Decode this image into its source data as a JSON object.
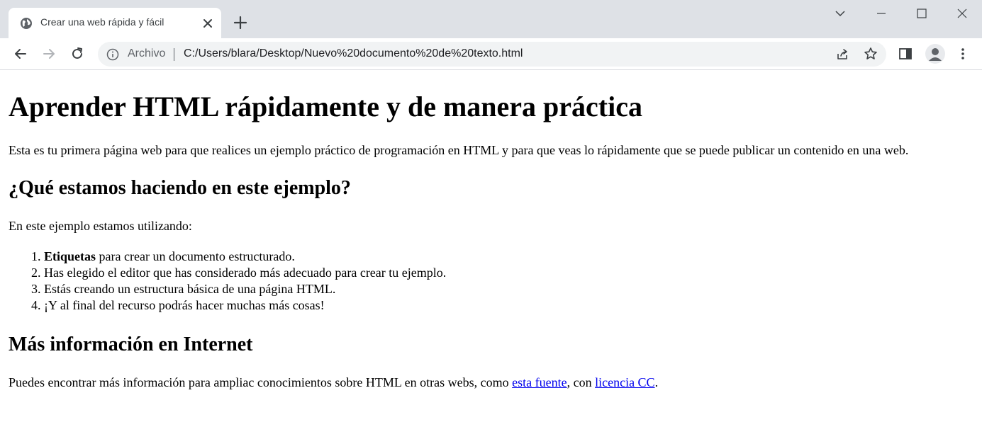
{
  "browser": {
    "tab": {
      "title": "Crear una web rápida y fácil"
    },
    "omnibox": {
      "chip": "Archivo",
      "url": "C:/Users/blara/Desktop/Nuevo%20documento%20de%20texto.html"
    },
    "icons": [
      "globe-icon",
      "close-icon",
      "plus-icon",
      "chevron-down-icon",
      "minimize-icon",
      "maximize-icon",
      "close-window-icon",
      "back-icon",
      "forward-icon",
      "reload-icon",
      "info-icon",
      "share-icon",
      "star-icon",
      "side-panel-icon",
      "avatar",
      "kebab-menu-icon"
    ]
  },
  "page": {
    "h1": "Aprender HTML rápidamente y de manera práctica",
    "intro": "Esta es tu primera página web para que realices un ejemplo práctico de programación en HTML y para que veas lo rápidamente que se puede publicar un contenido en una web.",
    "h2_what": "¿Qué estamos haciendo en este ejemplo?",
    "uses": "En este ejemplo estamos utilizando:",
    "list": [
      {
        "bold": "Etiquetas",
        "text": " para crear un documento estructurado."
      },
      {
        "text": "Has elegido el editor que has considerado más adecuado para crear tu ejemplo."
      },
      {
        "text": "Estás creando un estructura básica de una página HTML."
      },
      {
        "text": "¡Y al final del recurso podrás hacer muchas más cosas!"
      }
    ],
    "h2_more": "Más información en Internet",
    "more": {
      "before": "Puedes encontrar más información para ampliac conocimientos sobre HTML en otras webs, como ",
      "link1": "esta fuente",
      "middle": ", con ",
      "link2": "licencia CC",
      "after": "."
    }
  }
}
